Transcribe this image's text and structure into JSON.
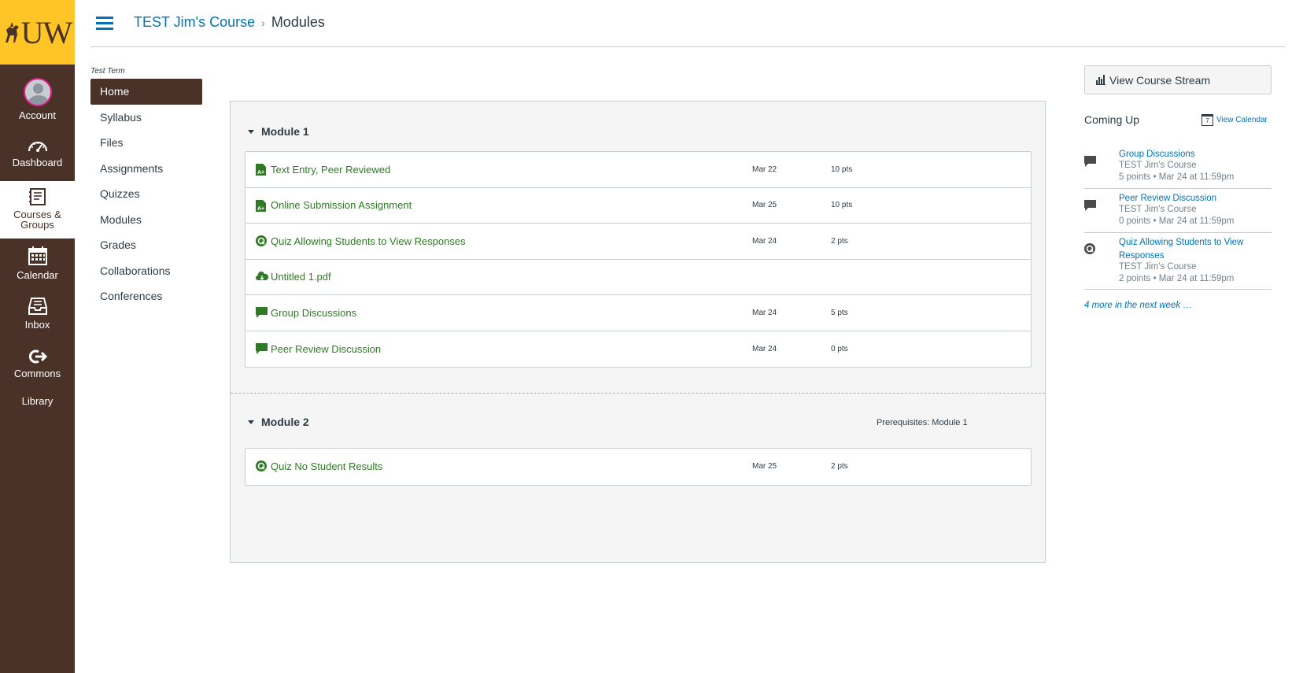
{
  "global_nav": {
    "logo_text": "UW",
    "items": [
      {
        "label": "Account",
        "icon": "account-avatar-icon"
      },
      {
        "label": "Dashboard",
        "icon": "dashboard-icon"
      },
      {
        "label": "Courses &\nGroups",
        "icon": "courses-icon"
      },
      {
        "label": "Calendar",
        "icon": "calendar-icon"
      },
      {
        "label": "Inbox",
        "icon": "inbox-icon"
      },
      {
        "label": "Commons",
        "icon": "commons-icon"
      },
      {
        "label": "Library",
        "icon": ""
      }
    ]
  },
  "header": {
    "breadcrumb_course": "TEST Jim's Course",
    "breadcrumb_sep": "›",
    "breadcrumb_current": "Modules"
  },
  "course_nav": {
    "term": "Test Term",
    "items": [
      "Home",
      "Syllabus",
      "Files",
      "Assignments",
      "Quizzes",
      "Modules",
      "Grades",
      "Collaborations",
      "Conferences"
    ]
  },
  "modules": [
    {
      "name": "Module 1",
      "items": [
        {
          "title": "Text Entry, Peer Reviewed",
          "type": "assignment-icon",
          "date": "Mar 22",
          "points": "10 pts"
        },
        {
          "title": "Online Submission Assignment",
          "type": "assignment-icon",
          "date": "Mar 25",
          "points": "10 pts"
        },
        {
          "title": "Quiz Allowing Students to View Responses",
          "type": "quiz-icon",
          "date": "Mar 24",
          "points": "2 pts"
        },
        {
          "title": "Untitled 1.pdf",
          "type": "file-icon",
          "date": "",
          "points": ""
        },
        {
          "title": "Group Discussions",
          "type": "discussion-icon",
          "date": "Mar 24",
          "points": "5 pts"
        },
        {
          "title": "Peer Review Discussion",
          "type": "discussion-icon",
          "date": "Mar 24",
          "points": "0 pts"
        }
      ]
    },
    {
      "name": "Module 2",
      "prerequisites": "Prerequisites: Module 1",
      "items": [
        {
          "title": "Quiz No Student Results",
          "type": "quiz-icon",
          "date": "Mar 25",
          "points": "2 pts"
        }
      ]
    }
  ],
  "sidebar": {
    "stream_button": "View Course Stream",
    "coming_up": "Coming Up",
    "view_calendar": "View Calendar",
    "calendar_icon_day": "7",
    "todos": [
      {
        "title": "Group Discussions",
        "course": "TEST Jim's Course",
        "meta": "5 points • Mar 24 at 11:59pm",
        "icon": "discussion-icon"
      },
      {
        "title": "Peer Review Discussion",
        "course": "TEST Jim's Course",
        "meta": "0 points • Mar 24 at 11:59pm",
        "icon": "discussion-icon"
      },
      {
        "title": "Quiz Allowing Students to View Responses",
        "course": "TEST Jim's Course",
        "meta": "2 points • Mar 24 at 11:59pm",
        "icon": "quiz-icon"
      }
    ],
    "more_link": "4 more in the next week …"
  },
  "colors": {
    "nav_bg": "#4a3228",
    "logo_bg": "#ffc425",
    "link_blue": "#0074b8",
    "item_green": "#2f7a25"
  }
}
